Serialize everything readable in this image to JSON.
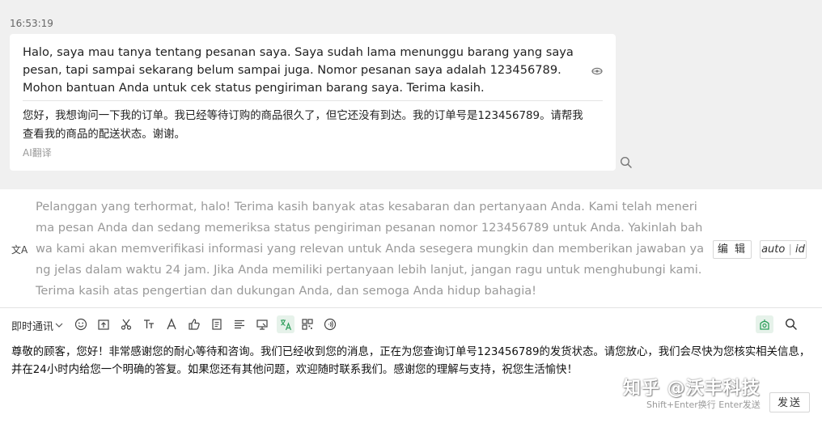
{
  "conversation": {
    "timestamp": "16:53:19",
    "incoming_message": "Halo, saya mau tanya tentang pesanan saya. Saya sudah lama menunggu barang yang saya pesan, tapi sampai sekarang belum sampai juga. Nomor pesanan saya adalah 123456789. Mohon bantuan Anda untuk cek status pengiriman barang saya. Terima kasih.",
    "translation": "您好，我想询问一下我的订单。我已经等待订购的商品很久了，但它还没有到达。我的订单号是123456789。请帮我查看我的商品的配送状态。谢谢。",
    "translation_label": "AI翻译",
    "eye_icon": "eye-icon",
    "search_icon": "search-icon"
  },
  "reply_suggestion": {
    "icon_glyph": "文A",
    "text": "Pelanggan yang terhormat, halo! Terima kasih banyak atas kesabaran dan pertanyaan Anda. Kami telah menerima pesan Anda dan sedang memeriksa status pengiriman pesanan nomor 123456789 untuk Anda. Yakinlah bahwa kami akan memverifikasi informasi yang relevan untuk Anda sesegera mungkin dan memberikan jawaban yang jelas dalam waktu 24 jam. Jika Anda memiliki pertanyaan lebih lanjut, jangan ragu untuk menghubungi kami. Terima kasih atas pengertian dan dukungan Anda, dan semoga Anda hidup bahagia!",
    "edit_label": "编 辑",
    "auto_label": "auto",
    "auto_suffix": "id"
  },
  "composer": {
    "mode_label": "即时通讯",
    "toolbar_icons": [
      "emoji-icon",
      "upload-icon",
      "scissors-icon",
      "text-format-icon",
      "font-color-icon",
      "thumbs-up-icon",
      "document-icon",
      "align-icon",
      "screen-icon",
      "translate-icon",
      "qrcode-icon",
      "voice-icon",
      "robot-icon",
      "search-icon"
    ],
    "text": "尊敬的顾客，您好！非常感谢您的耐心等待和咨询。我们已经收到您的消息，正在为您查询订单号123456789的发货状态。请您放心，我们会尽快为您核实相关信息，并在24小时内给您一个明确的答复。如果您还有其他问题，欢迎随时联系我们。感谢您的理解与支持，祝您生活愉快！",
    "hint": "Shift+Enter换行 Enter发送",
    "send_label": "发送"
  },
  "watermark": "知乎 @沃丰科技",
  "colors": {
    "accent_green": "#2e9e5b",
    "background": "#f0f0f0"
  }
}
